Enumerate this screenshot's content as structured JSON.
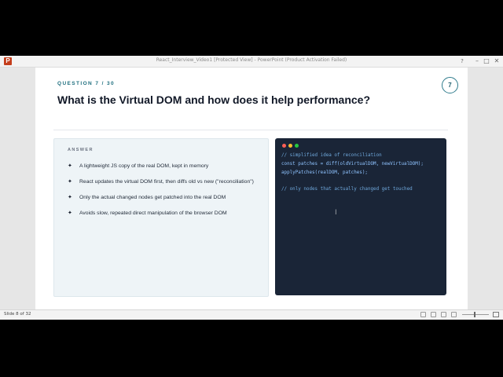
{
  "window": {
    "title": "React_Interview_Video1 [Protected View] - PowerPoint (Product Activation Failed)",
    "app_icon": "P",
    "help_label": "?",
    "min_label": "–",
    "max_label": "□",
    "close_label": "✕"
  },
  "slide": {
    "question_label": "QUESTION 7 / 30",
    "title": "What is the Virtual DOM and how does it help performance?",
    "badge": "7",
    "answer_label": "ANSWER",
    "bullet_glyph": "✦",
    "bullets": [
      "A lightweight JS copy of the real DOM, kept in memory",
      "React updates the virtual DOM first, then diffs old vs new (\"reconciliation\")",
      "Only the actual changed nodes get patched into the real DOM",
      "Avoids slow, repeated direct manipulation of the browser DOM"
    ],
    "code_lines": [
      "// simplified idea of reconciliation",
      "const patches = diff(oldVirtualDOM, newVirtualDOM);",
      "applyPatches(realDOM, patches);",
      "",
      "// only nodes that actually changed get touched"
    ],
    "text_cursor": "I"
  },
  "statusbar": {
    "slide_info": "Slide 8 of 32"
  },
  "colors": {
    "accent": "#1f6f7f",
    "code_bg": "#1a2537",
    "answer_bg": "#eef4f7"
  }
}
